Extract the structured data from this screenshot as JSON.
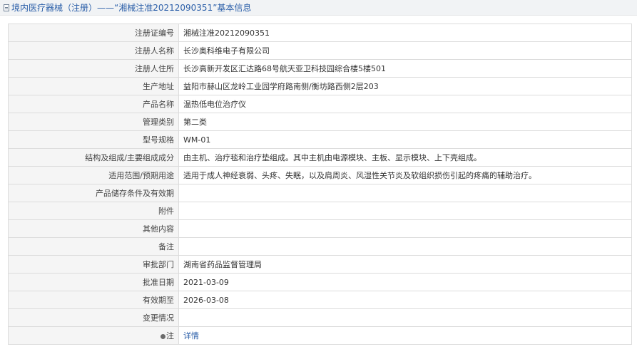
{
  "header": {
    "title": "境内医疗器械（注册）——“湘械注准20212090351”基本信息",
    "icon": "document-icon"
  },
  "rows": [
    {
      "label": "注册证编号",
      "value": "湘械注准20212090351"
    },
    {
      "label": "注册人名称",
      "value": "长沙奥科维电子有限公司"
    },
    {
      "label": "注册人住所",
      "value": "长沙高新开发区汇达路68号航天亚卫科技园综合楼5楼501"
    },
    {
      "label": "生产地址",
      "value": "益阳市赫山区龙岭工业园学府路南侧/衡坊路西侧2层203"
    },
    {
      "label": "产品名称",
      "value": "温热低电位治疗仪"
    },
    {
      "label": "管理类别",
      "value": "第二类"
    },
    {
      "label": "型号规格",
      "value": "WM-01"
    },
    {
      "label": "结构及组成/主要组成成分",
      "value": "由主机、治疗毯和治疗垫组成。其中主机由电源模块、主板、显示模块、上下壳组成。"
    },
    {
      "label": "适用范围/预期用途",
      "value": "适用于成人神经衰弱、头疼、失眠，以及肩周炎、风湿性关节炎及软组织损伤引起的疼痛的辅助治疗。"
    },
    {
      "label": "产品储存条件及有效期",
      "value": ""
    },
    {
      "label": "附件",
      "value": ""
    },
    {
      "label": "其他内容",
      "value": ""
    },
    {
      "label": "备注",
      "value": ""
    },
    {
      "label": "审批部门",
      "value": "湖南省药品监督管理局"
    },
    {
      "label": "批准日期",
      "value": "2021-03-09"
    },
    {
      "label": "有效期至",
      "value": "2026-03-08"
    },
    {
      "label": "变更情况",
      "value": ""
    }
  ],
  "note": {
    "label": "注",
    "link": "详情",
    "icon": "pin-icon"
  },
  "colors": {
    "link": "#2a5ea8",
    "label_bg": "#f5f5f5",
    "border": "#dcdcdc",
    "header_bg": "#f1f3f5"
  }
}
